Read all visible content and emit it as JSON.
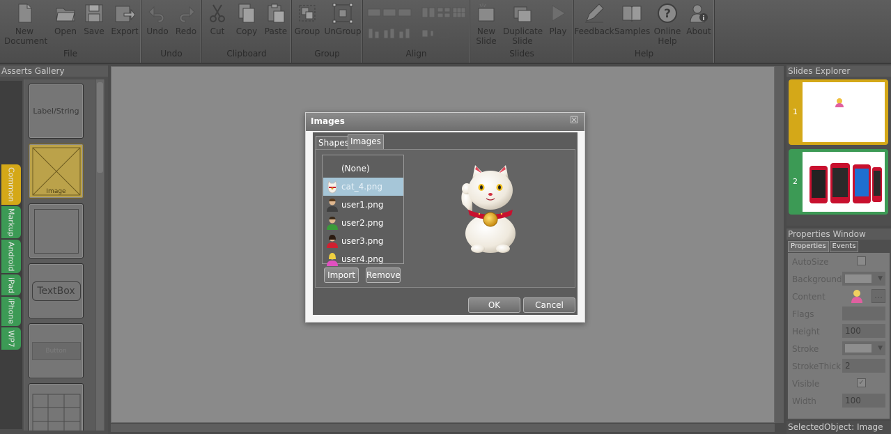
{
  "ribbon": {
    "groups": {
      "file": "File",
      "undo": "Undo",
      "clipboard": "Clipboard",
      "group": "Group",
      "align": "Align",
      "slides": "Slides",
      "help": "Help"
    },
    "buttons": {
      "new_document": "New Document",
      "open": "Open",
      "save": "Save",
      "export": "Export",
      "undo": "Undo",
      "redo": "Redo",
      "cut": "Cut",
      "copy": "Copy",
      "paste": "Paste",
      "group": "Group",
      "ungroup": "UnGroup",
      "new_slide": "New Slide",
      "duplicate_slide": "Duplicate Slide",
      "play": "Play",
      "feedback": "Feedback",
      "samples": "Samples",
      "online_help": "Online Help",
      "about": "About"
    }
  },
  "assets_gallery": {
    "title": "Asserts Gallery",
    "tabs": [
      "Common",
      "Markup",
      "Android",
      "iPad",
      "iPhone",
      "WP7"
    ],
    "items": {
      "label_string": "Label/String",
      "image": "Image",
      "textbox": "TextBox",
      "button": "Button"
    }
  },
  "slides_explorer": {
    "title": "Slides Explorer",
    "slides": [
      "1",
      "2"
    ]
  },
  "properties_window": {
    "title": "Properties Window",
    "tabs": {
      "properties": "Properties",
      "events": "Events"
    },
    "rows": {
      "autosize": "AutoSize",
      "background": "Background",
      "content": "Content",
      "flags": "Flags",
      "height": "Height",
      "height_value": "100",
      "stroke": "Stroke",
      "strokethick": "StrokeThick",
      "strokethick_value": "2",
      "visible": "Visible",
      "width": "Width",
      "width_value": "100"
    }
  },
  "status": {
    "selected_object": "SelectedObject: Image"
  },
  "dialog": {
    "title": "Images",
    "close": "☒",
    "tabs": {
      "shapes": "Shapes",
      "images": "Images"
    },
    "list": [
      "(None)",
      "cat_4.png",
      "user1.png",
      "user2.png",
      "user3.png",
      "user4.png"
    ],
    "import": "Import",
    "remove": "Remove",
    "ok": "OK",
    "cancel": "Cancel"
  },
  "colors": {
    "accent_yellow": "#d4a818",
    "accent_green": "#3c9a55",
    "selection_blue": "#a6c6d8"
  }
}
